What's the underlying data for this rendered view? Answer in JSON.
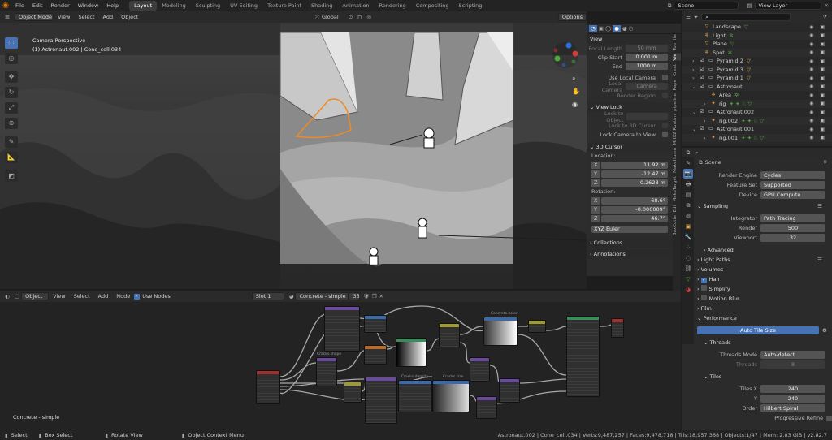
{
  "topbar": {
    "menus": [
      "File",
      "Edit",
      "Render",
      "Window",
      "Help"
    ],
    "workspaces": [
      "Layout",
      "Modeling",
      "Sculpting",
      "UV Editing",
      "Texture Paint",
      "Shading",
      "Animation",
      "Rendering",
      "Compositing",
      "Scripting"
    ],
    "active_workspace": "Layout",
    "scene": "Scene",
    "view_layer": "View Layer"
  },
  "viewport_header": {
    "mode": "Object Mode",
    "menus": [
      "View",
      "Select",
      "Add",
      "Object"
    ],
    "orientation": "Global",
    "options": "Options"
  },
  "viewport": {
    "camera_label": "Camera Perspective",
    "object_label": "(1) Astronaut.002 | Cone_cell.034"
  },
  "npanel": {
    "view_title": "View",
    "focal_length_label": "Focal Length",
    "focal_length": "50 mm",
    "clip_start_label": "Clip Start",
    "clip_start": "0.001 m",
    "end_label": "End",
    "end": "1000 m",
    "use_local_camera": "Use Local Camera",
    "local_camera_label": "Local Camera",
    "local_camera": "Camera",
    "render_region": "Render Region",
    "view_lock_title": "View Lock",
    "lock_to_object": "Lock to Object",
    "lock_to_3d_cursor": "Lock to 3D Cursor",
    "lock_camera_to_view": "Lock Camera to View",
    "cursor_title": "3D Cursor",
    "location_label": "Location:",
    "loc_x": "11.92 m",
    "loc_y": "-12.47 m",
    "loc_z": "0.2623 m",
    "rotation_label": "Rotation:",
    "rot_x": "68.6°",
    "rot_y": "-0.000009°",
    "rot_z": "46.7°",
    "rotation_mode": "XYZ Euler",
    "collections": "Collections",
    "annotations": "Annotations",
    "axis_x": "X",
    "axis_y": "Y",
    "axis_z": "Z"
  },
  "vtabs": [
    "Ite",
    "Too",
    "Vie",
    "Creat",
    "Pape",
    "pipeline",
    "MHX2 Runtim",
    "MakeHuma",
    "MakeTarget",
    "Edi",
    "BoxCutte"
  ],
  "node_header": {
    "type": "Object",
    "menus": [
      "View",
      "Select",
      "Add",
      "Node"
    ],
    "use_nodes": "Use Nodes",
    "slot": "Slot 1",
    "material": "Concrete - simple",
    "users": "35"
  },
  "node_editor": {
    "material_label": "Concrete - simple",
    "node_titles": [
      "Cracks.shape",
      "Cracks.bump",
      "Cracks.density",
      "Cracks.size",
      "Concrete.color",
      "Concrete.roughness"
    ]
  },
  "outliner": {
    "search_placeholder": "",
    "items": [
      {
        "name": "Landscape",
        "icon": "mesh",
        "color": "#e5a84b"
      },
      {
        "name": "Light",
        "icon": "light",
        "color": "#e5a84b"
      },
      {
        "name": "Plane",
        "icon": "mesh",
        "color": "#e5a84b"
      },
      {
        "name": "Spot",
        "icon": "light",
        "color": "#e5a84b"
      },
      {
        "name": "Pyramid 2",
        "icon": "coll",
        "color": "#ddd"
      },
      {
        "name": "Pyramid 3",
        "icon": "coll",
        "color": "#ddd"
      },
      {
        "name": "Pyramid 1",
        "icon": "coll",
        "color": "#ddd"
      },
      {
        "name": "Astronaut",
        "icon": "coll",
        "color": "#ddd"
      },
      {
        "name": "Area",
        "icon": "light",
        "color": "#e5a84b"
      },
      {
        "name": "rig",
        "icon": "armature",
        "color": "#e5a84b"
      },
      {
        "name": "Astronaut.002",
        "icon": "coll",
        "color": "#ddd"
      },
      {
        "name": "rig.002",
        "icon": "armature",
        "color": "#e5a84b"
      },
      {
        "name": "Astronaut.001",
        "icon": "coll",
        "color": "#ddd"
      },
      {
        "name": "rig.001",
        "icon": "armature",
        "color": "#e5a84b"
      }
    ]
  },
  "properties": {
    "scene": "Scene",
    "render_engine_label": "Render Engine",
    "render_engine": "Cycles",
    "feature_set_label": "Feature Set",
    "feature_set": "Supported",
    "device_label": "Device",
    "device": "GPU Compute",
    "sampling": "Sampling",
    "integrator_label": "Integrator",
    "integrator": "Path Tracing",
    "render_label": "Render",
    "render_samples": "500",
    "viewport_label": "Viewport",
    "viewport_samples": "32",
    "advanced": "Advanced",
    "light_paths": "Light Paths",
    "volumes": "Volumes",
    "hair": "Hair",
    "simplify": "Simplify",
    "motion_blur": "Motion Blur",
    "film": "Film",
    "performance": "Performance",
    "auto_tile_size": "Auto Tile Size",
    "threads": "Threads",
    "threads_mode_label": "Threads Mode",
    "threads_mode": "Auto-detect",
    "threads_label": "Threads",
    "threads_value": "8",
    "tiles": "Tiles",
    "tiles_x_label": "Tiles X",
    "tiles_x": "240",
    "y_label": "Y",
    "tiles_y": "240",
    "order_label": "Order",
    "order": "Hilbert Spiral",
    "progressive_refine": "Progressive Refine"
  },
  "statusbar": {
    "select": "Select",
    "box_select": "Box Select",
    "rotate_view": "Rotate View",
    "context_menu": "Object Context Menu",
    "stats": "Astronaut.002 | Cone_cell.034 | Verts:9,487,257 | Faces:9,478,718 | Tris:18,957,368 | Objects:1/47 | Mem: 2.83 GiB | v2.82.7"
  },
  "colors": {
    "accent": "#4772b3",
    "selection_orange": "#f08a24",
    "node_purple": "#6a4a9c",
    "node_orange": "#b86a2a",
    "node_blue": "#3a6aa8",
    "node_green": "#3d8a5a",
    "node_red": "#a03030",
    "node_yellow": "#a09a30"
  }
}
